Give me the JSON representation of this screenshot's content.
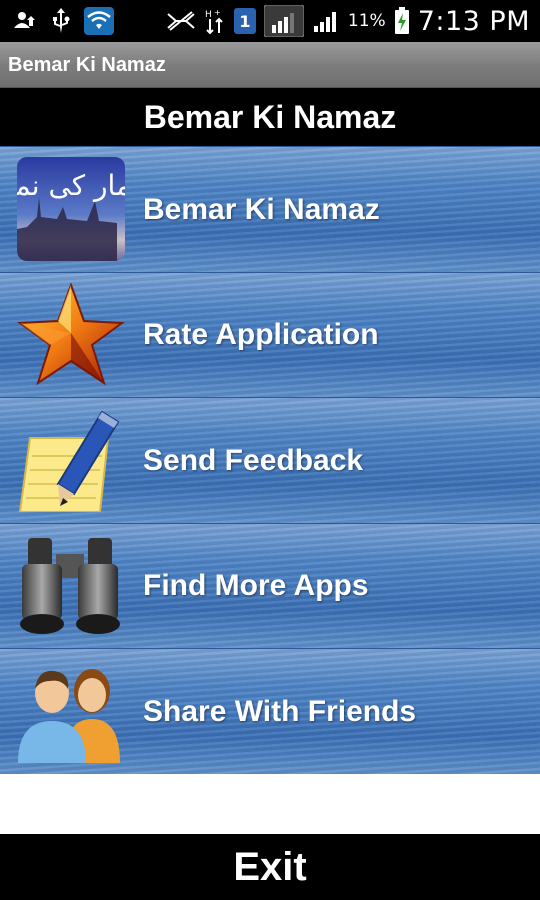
{
  "status_bar": {
    "badge_number": "1",
    "battery_percent": "11%",
    "time": "7:13 PM"
  },
  "title_bar": {
    "title": "Bemar Ki Namaz"
  },
  "header": {
    "title": "Bemar Ki Namaz"
  },
  "menu": {
    "items": [
      {
        "label": "Bemar Ki Namaz",
        "icon": "urdu-calligraphy-icon",
        "urdu_text": "بیمار کی نماز"
      },
      {
        "label": "Rate Application",
        "icon": "star-icon"
      },
      {
        "label": "Send Feedback",
        "icon": "pencil-notepad-icon"
      },
      {
        "label": "Find More Apps",
        "icon": "binoculars-icon"
      },
      {
        "label": "Share With Friends",
        "icon": "people-icon"
      }
    ]
  },
  "exit": {
    "label": "Exit"
  },
  "colors": {
    "menu_blue": "#4e84c6",
    "header_black": "#000000",
    "titlebar_gray": "#8a8a8a"
  }
}
